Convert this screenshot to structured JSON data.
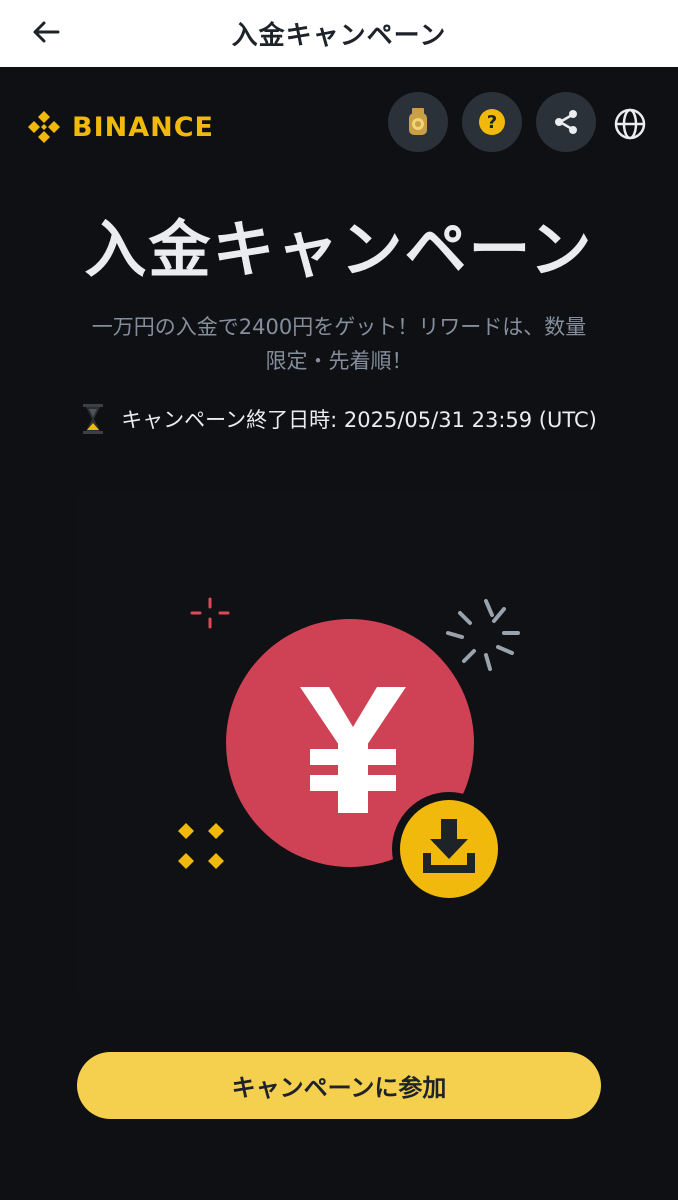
{
  "header": {
    "title": "入金キャンペーン"
  },
  "brand": {
    "name": "BINANCE",
    "color": "#f0b90b"
  },
  "toolbar": {
    "icons": [
      "medal-icon",
      "help-icon",
      "share-icon",
      "globe-icon"
    ]
  },
  "hero": {
    "title": "入金キャンペーン",
    "subtitle_line1": "一万円の入金で2400円をゲット！リワードは、数量",
    "subtitle_line2": "限定・先着順！",
    "end_time": "キャンペーン終了日時: 2025/05/31 23:59 (UTC)"
  },
  "illustration": {
    "symbol": "¥",
    "coin_color": "#cf4155",
    "badge_color": "#f0b90b"
  },
  "cta": {
    "label": "キャンペーンに参加",
    "color": "#f5d04e"
  }
}
